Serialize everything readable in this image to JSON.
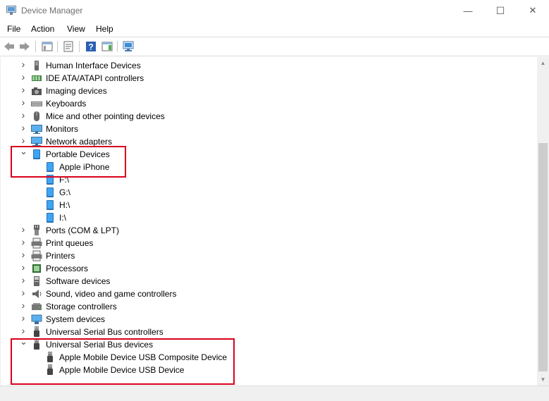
{
  "window": {
    "title": "Device Manager",
    "minimize_glyph": "—",
    "maximize_glyph": "☐",
    "close_glyph": "✕"
  },
  "menu": [
    "File",
    "Action",
    "View",
    "Help"
  ],
  "toolbar_icons": [
    "back-arrow-icon",
    "forward-arrow-icon",
    "show-hide-console-tree-icon",
    "properties-icon",
    "help-icon",
    "action-pane-icon",
    "scan-hardware-icon"
  ],
  "tree": [
    {
      "label": "Human Interface Devices",
      "icon": "hid-icon",
      "expanded": false
    },
    {
      "label": "IDE ATA/ATAPI controllers",
      "icon": "ide-controller-icon",
      "expanded": false
    },
    {
      "label": "Imaging devices",
      "icon": "camera-icon",
      "expanded": false
    },
    {
      "label": "Keyboards",
      "icon": "keyboard-icon",
      "expanded": false
    },
    {
      "label": "Mice and other pointing devices",
      "icon": "mouse-icon",
      "expanded": false
    },
    {
      "label": "Monitors",
      "icon": "monitor-icon",
      "expanded": false
    },
    {
      "label": "Network adapters",
      "icon": "network-adapter-icon",
      "expanded": false
    },
    {
      "label": "Portable Devices",
      "icon": "portable-device-icon",
      "expanded": true,
      "children": [
        {
          "label": "Apple iPhone",
          "icon": "portable-device-icon"
        },
        {
          "label": "F:\\",
          "icon": "portable-device-icon"
        },
        {
          "label": "G:\\",
          "icon": "portable-device-icon"
        },
        {
          "label": "H:\\",
          "icon": "portable-device-icon"
        },
        {
          "label": "I:\\",
          "icon": "portable-device-icon"
        }
      ]
    },
    {
      "label": "Ports (COM & LPT)",
      "icon": "port-icon",
      "expanded": false
    },
    {
      "label": "Print queues",
      "icon": "printer-icon",
      "expanded": false
    },
    {
      "label": "Printers",
      "icon": "printer-icon",
      "expanded": false
    },
    {
      "label": "Processors",
      "icon": "processor-icon",
      "expanded": false
    },
    {
      "label": "Software devices",
      "icon": "software-device-icon",
      "expanded": false
    },
    {
      "label": "Sound, video and game controllers",
      "icon": "speaker-icon",
      "expanded": false
    },
    {
      "label": "Storage controllers",
      "icon": "storage-controller-icon",
      "expanded": false
    },
    {
      "label": "System devices",
      "icon": "system-device-icon",
      "expanded": false
    },
    {
      "label": "Universal Serial Bus controllers",
      "icon": "usb-icon",
      "expanded": false
    },
    {
      "label": "Universal Serial Bus devices",
      "icon": "usb-icon",
      "expanded": true,
      "children": [
        {
          "label": "Apple Mobile Device USB Composite Device",
          "icon": "usb-icon"
        },
        {
          "label": "Apple Mobile Device USB Device",
          "icon": "usb-icon"
        }
      ]
    }
  ],
  "colors": {
    "highlight_border": "#d9001b",
    "icon_blue": "#1e8ad6"
  }
}
